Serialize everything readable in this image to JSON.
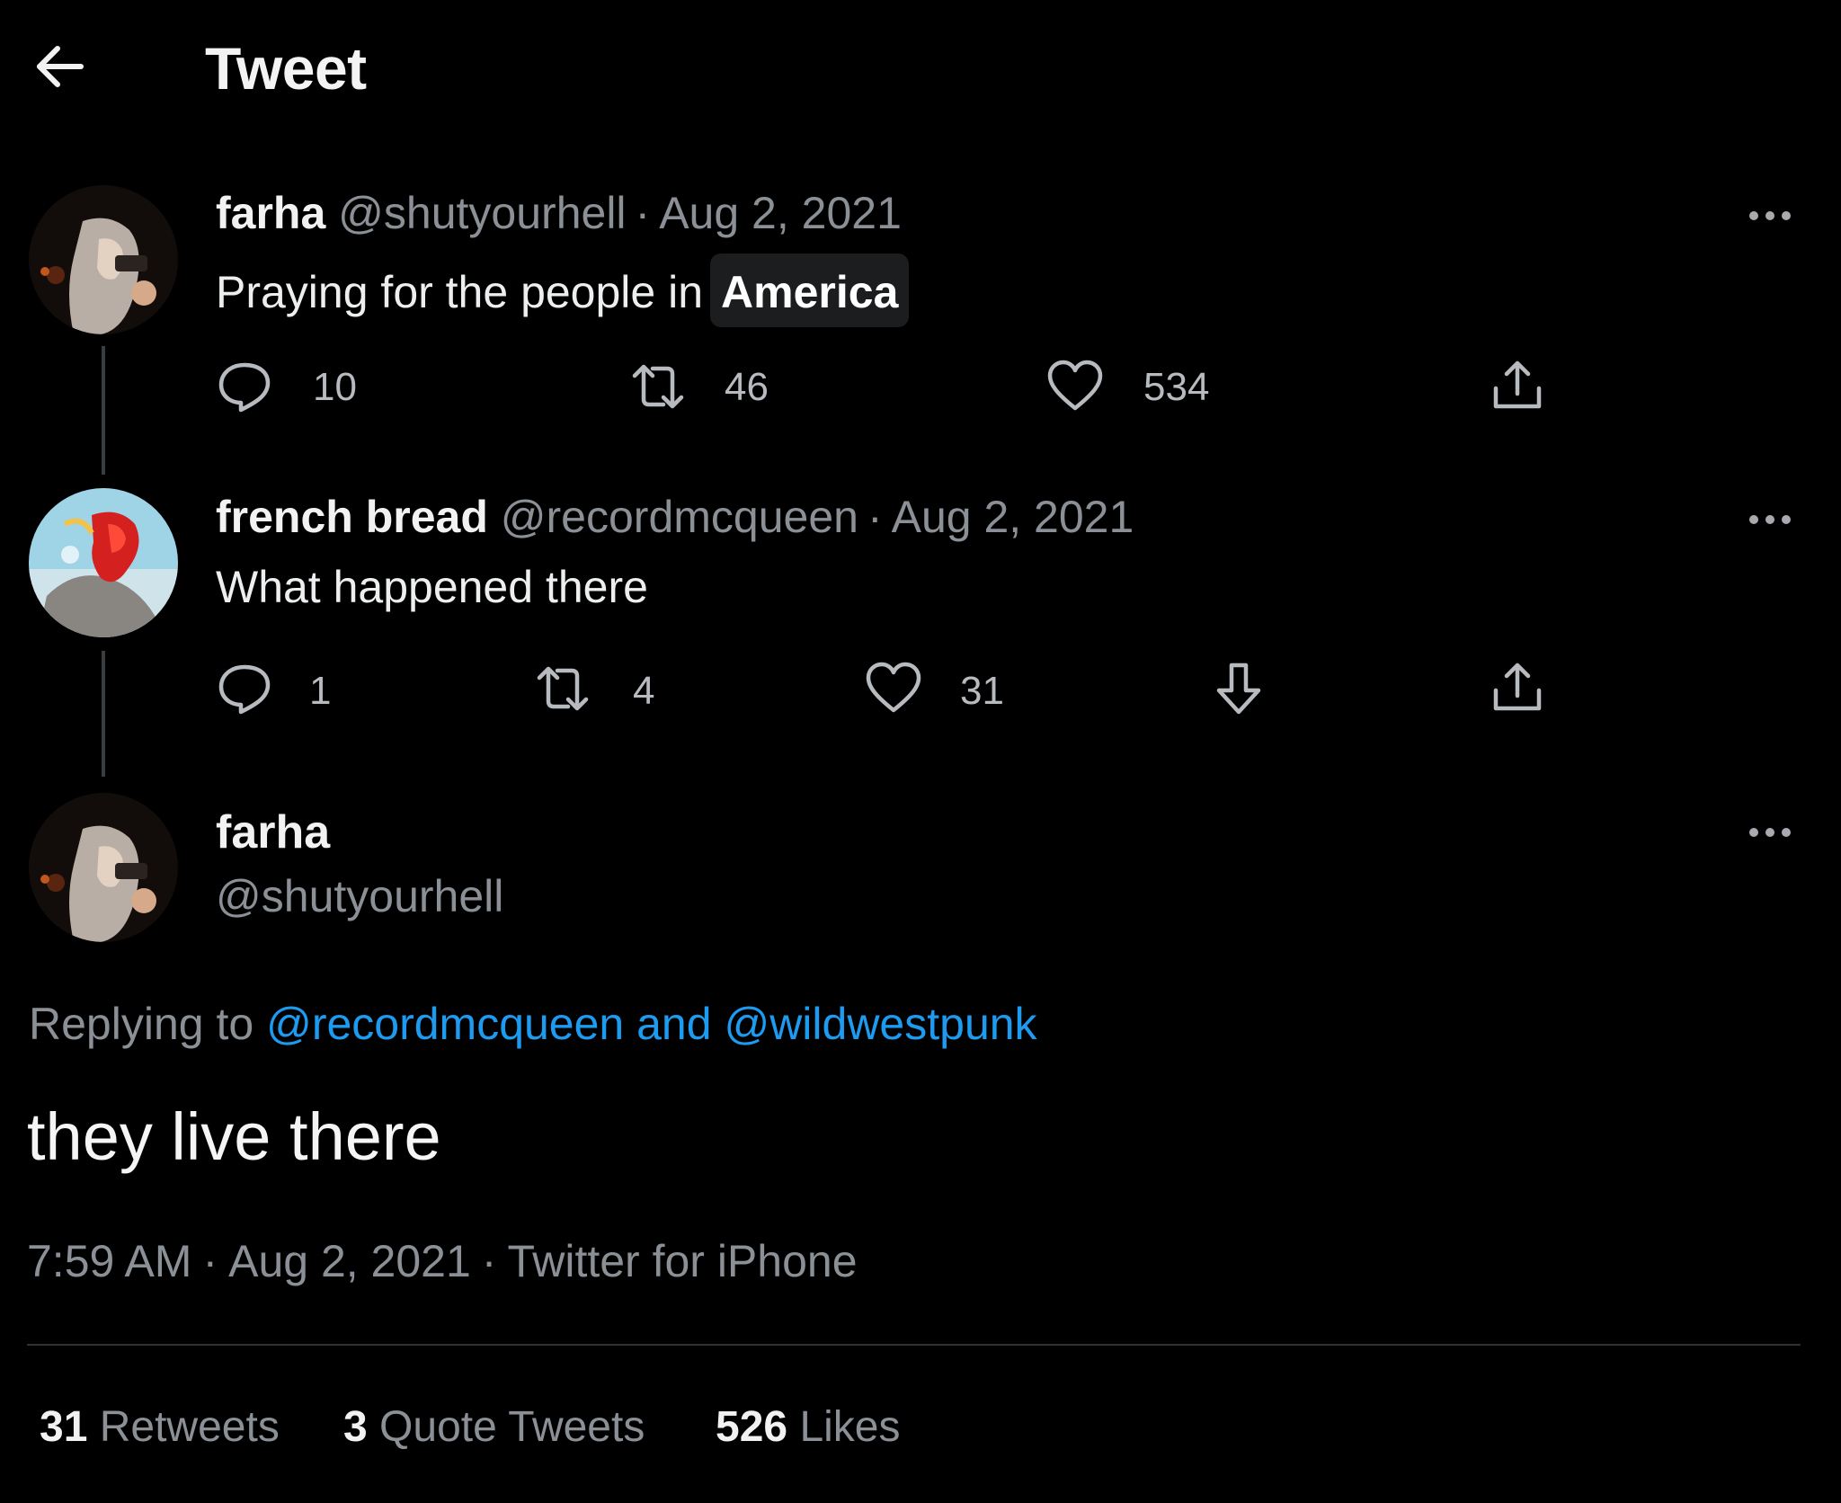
{
  "header": {
    "title": "Tweet",
    "back_icon": "arrow-left-icon"
  },
  "thread": [
    {
      "name": "farha",
      "handle": "@shutyourhell",
      "separator": "·",
      "date": "Aug 2, 2021",
      "text": "Praying for the people in",
      "highlight": "America",
      "actions": {
        "reply_count": "10",
        "retweet_count": "46",
        "like_count": "534"
      }
    },
    {
      "name": "french bread",
      "handle": "@recordmcqueen",
      "separator": "·",
      "date": "Aug 2, 2021",
      "text": "What happened there",
      "actions": {
        "reply_count": "1",
        "retweet_count": "4",
        "like_count": "31"
      }
    }
  ],
  "main_tweet": {
    "name": "farha",
    "handle": "@shutyourhell",
    "replying_prefix": "Replying to",
    "replying_users": "@recordmcqueen and @wildwestpunk",
    "text": "they live there",
    "time": "7:59 AM",
    "separator": "·",
    "date": "Aug 2, 2021",
    "source": "Twitter for iPhone"
  },
  "stats": {
    "retweets_count": "31",
    "retweets_label": "Retweets",
    "quotes_count": "3",
    "quotes_label": "Quote Tweets",
    "likes_count": "526",
    "likes_label": "Likes"
  },
  "colors": {
    "background": "#000000",
    "link": "#1d9bf0",
    "muted": "#8b9096",
    "text": "#e7e9ea"
  }
}
